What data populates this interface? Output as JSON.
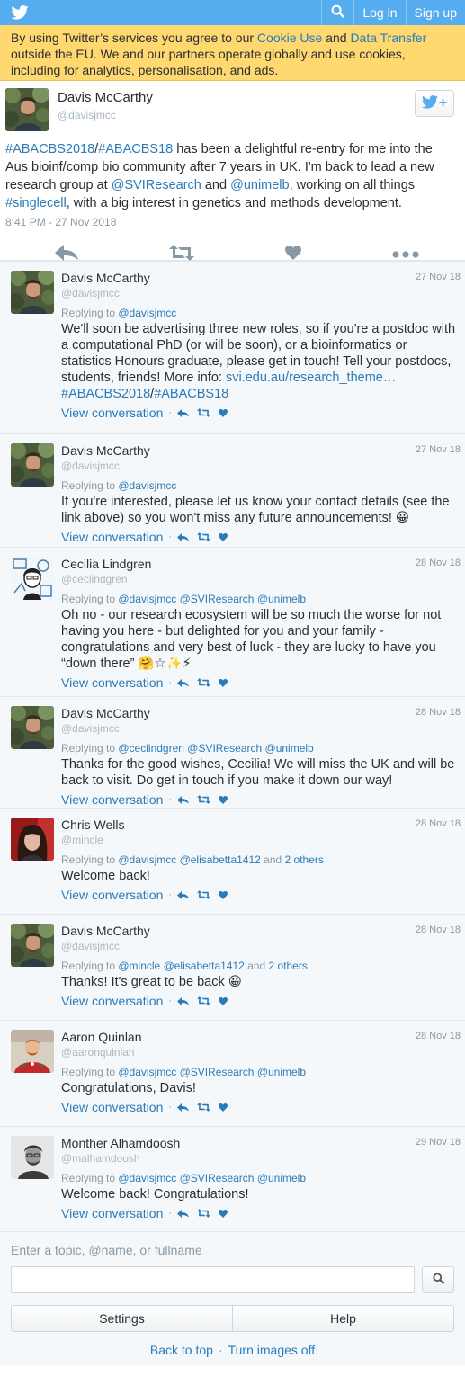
{
  "topbar": {
    "login": "Log in",
    "signup": "Sign up",
    "icons": [
      "twitter-bird-icon",
      "search-icon"
    ],
    "brand_color": "#55acee"
  },
  "cookie": {
    "text_before": "By using Twitter’s services you agree to our ",
    "cookie_link": "Cookie Use",
    "text_and": " and ",
    "transfer_link": "Data Transfer",
    "text_after": " outside the EU. We and our partners operate globally and use cookies, including for analytics, personalisation, and ads."
  },
  "main_tweet": {
    "fullname": "Davis McCarthy",
    "screenname": "@davisjmcc",
    "text": [
      {
        "t": "#ABACBS2018",
        "link": true
      },
      {
        "t": "/",
        "link": false
      },
      {
        "t": "#ABACBS18",
        "link": true
      },
      {
        "t": " has been a delightful re-entry for me into the Aus bioinf/comp bio community after 7 years in UK. I'm back to lead a new research group at ",
        "link": false
      },
      {
        "t": "@SVIResearch",
        "link": true
      },
      {
        "t": " and ",
        "link": false
      },
      {
        "t": "@unimelb",
        "link": true
      },
      {
        "t": ", working on all things ",
        "link": false
      },
      {
        "t": "#singlecell",
        "link": true
      },
      {
        "t": ", with a big interest in genetics and methods development.",
        "link": false
      }
    ],
    "time": "8:41 PM - 27 Nov 2018"
  },
  "replies": [
    {
      "avatar": "davis",
      "fullname": "Davis McCarthy",
      "screenname": "@davisjmcc",
      "date": "27 Nov 18",
      "replying_prefix": "Replying to ",
      "replying": [
        "@davisjmcc"
      ],
      "replying_suffix": "",
      "text": [
        {
          "t": "We'll soon be advertising three new roles, so if you're a postdoc with a computational PhD (or will be soon), or a bioinformatics or statistics Honours graduate, please get in touch! Tell your postdocs, students, friends! More info: ",
          "link": false
        },
        {
          "t": "svi.edu.au/research_theme…",
          "link": true
        },
        {
          "t": " ",
          "link": false
        },
        {
          "t": "#ABACBS2018",
          "link": true
        },
        {
          "t": "/",
          "link": false
        },
        {
          "t": "#ABACBS18",
          "link": true
        }
      ],
      "view": "View conversation"
    },
    {
      "avatar": "davis",
      "fullname": "Davis McCarthy",
      "screenname": "@davisjmcc",
      "date": "27 Nov 18",
      "replying_prefix": "Replying to ",
      "replying": [
        "@davisjmcc"
      ],
      "replying_suffix": "",
      "text": [
        {
          "t": "If you're interested, please let us know your contact details (see the link above) so you won't miss any future announcements! 😀",
          "link": false
        }
      ],
      "view": "View conversation"
    },
    {
      "avatar": "cecilia",
      "fullname": "Cecilia Lindgren",
      "screenname": "@ceclindgren",
      "date": "28 Nov 18",
      "replying_prefix": "Replying to ",
      "replying": [
        "@davisjmcc",
        "@SVIResearch",
        "@unimelb"
      ],
      "replying_suffix": "",
      "text": [
        {
          "t": "Oh no - our research ecosystem will be so much the worse for not having you here - but delighted for you and your family - congratulations and very best of luck - they are lucky to have you “down there” 🤗☆✨⚡",
          "link": false
        }
      ],
      "view": "View conversation"
    },
    {
      "avatar": "davis",
      "fullname": "Davis McCarthy",
      "screenname": "@davisjmcc",
      "date": "28 Nov 18",
      "replying_prefix": "Replying to ",
      "replying": [
        "@ceclindgren",
        "@SVIResearch",
        "@unimelb"
      ],
      "replying_suffix": "",
      "text": [
        {
          "t": "Thanks for the good wishes, Cecilia! We will miss the UK and will be back to visit. Do get in touch if you make it down our way!",
          "link": false
        }
      ],
      "view": "View conversation"
    },
    {
      "avatar": "chris",
      "fullname": "Chris Wells",
      "screenname": "@mincle",
      "date": "28 Nov 18",
      "replying_prefix": "Replying to ",
      "replying": [
        "@davisjmcc",
        "@elisabetta1412"
      ],
      "replying_suffix": " and ",
      "replying_others": "2 others",
      "text": [
        {
          "t": "Welcome back!",
          "link": false
        }
      ],
      "view": "View conversation"
    },
    {
      "avatar": "davis",
      "fullname": "Davis McCarthy",
      "screenname": "@davisjmcc",
      "date": "28 Nov 18",
      "replying_prefix": "Replying to ",
      "replying": [
        "@mincle",
        "@elisabetta1412"
      ],
      "replying_suffix": " and ",
      "replying_others": "2 others",
      "text": [
        {
          "t": "Thanks! It's great to be back 😀",
          "link": false
        }
      ],
      "view": "View conversation"
    },
    {
      "avatar": "aaron",
      "fullname": "Aaron Quinlan",
      "screenname": "@aaronquinlan",
      "date": "28 Nov 18",
      "replying_prefix": "Replying to ",
      "replying": [
        "@davisjmcc",
        "@SVIResearch",
        "@unimelb"
      ],
      "replying_suffix": "",
      "text": [
        {
          "t": "Congratulations, Davis!",
          "link": false
        }
      ],
      "view": "View conversation"
    },
    {
      "avatar": "monther",
      "fullname": "Monther Alhamdoosh",
      "screenname": "@malhamdoosh",
      "date": "29 Nov 18",
      "replying_prefix": "Replying to ",
      "replying": [
        "@davisjmcc",
        "@SVIResearch",
        "@unimelb"
      ],
      "replying_suffix": "",
      "text": [
        {
          "t": "Welcome back! Congratulations!",
          "link": false
        }
      ],
      "view": "View conversation"
    }
  ],
  "footer": {
    "search_label": "Enter a topic, @name, or fullname",
    "search_value": "",
    "settings": "Settings",
    "help": "Help",
    "back_to_top": "Back to top",
    "dot": "·",
    "images_off": "Turn images off"
  },
  "colors": {
    "link": "#2b7bb9",
    "muted": "#8899a6",
    "cookie_bg": "#ffd86f",
    "reply_bg": "#f5f8fa"
  }
}
